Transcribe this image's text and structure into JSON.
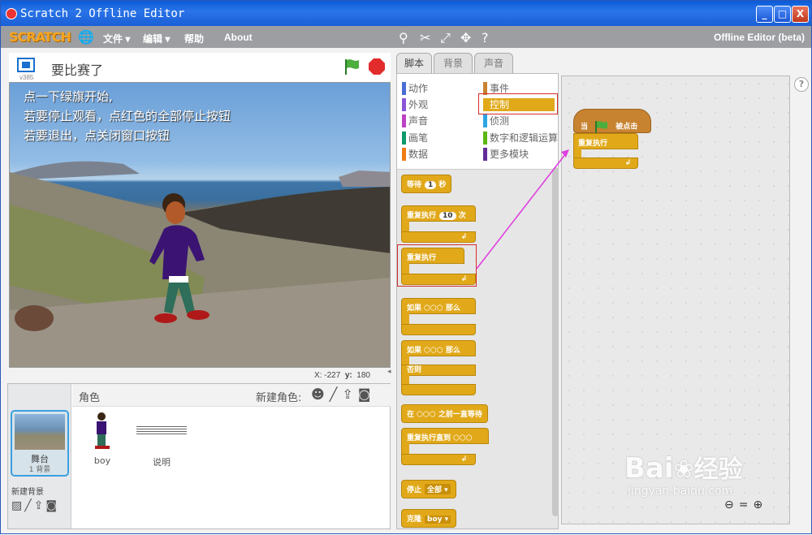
{
  "window": {
    "title": "Scratch 2 Offline Editor",
    "min": "_",
    "max": "□",
    "close": "X"
  },
  "menu": {
    "logo": "SCRATCH",
    "items": [
      "文件",
      "编辑",
      "帮助",
      "About"
    ],
    "file": "文件",
    "edit": "编辑",
    "help": "帮助",
    "about": "About",
    "right_label": "Offline Editor (beta)"
  },
  "stage": {
    "project_title": "要比赛了",
    "version": "v385",
    "lines": [
      "点一下绿旗开始,",
      "若要停止观看，点红色的全部停止按钮",
      "若要退出，点关闭窗口按钮"
    ],
    "x_label": "X:",
    "x_value": "-227",
    "y_label": "y:",
    "y_value": "180"
  },
  "sprites": {
    "header": "角色",
    "new_sprite_label": "新建角色:",
    "stage_name": "舞台",
    "stage_backdrops": "1 背景",
    "new_backdrop_label": "新建背景",
    "items": [
      {
        "name": "boy"
      },
      {
        "name": "说明"
      }
    ]
  },
  "tabs": {
    "scripts": "脚本",
    "backdrops": "背景",
    "sounds": "声音"
  },
  "categories": {
    "motion": "动作",
    "looks": "外观",
    "sound": "声音",
    "pen": "画笔",
    "data": "数据",
    "events": "事件",
    "control": "控制",
    "sensing": "侦测",
    "operators": "数字和逻辑运算",
    "more": "更多模块"
  },
  "blocks": {
    "wait": "等待",
    "wait_val": "1",
    "wait_unit": "秒",
    "repeat": "重复执行",
    "repeat_val": "10",
    "repeat_unit": "次",
    "forever": "重复执行",
    "if": "如果",
    "then": "那么",
    "if2": "如果",
    "then2": "那么",
    "else": "否则",
    "wait_until": "在",
    "wait_until2": "之前一直等待",
    "repeat_until": "重复执行直到",
    "stop": "停止",
    "stop_opt": "全部",
    "when_clone": "克隆",
    "clone_opt": "boy"
  },
  "script": {
    "hat": "当",
    "hat2": "被点击",
    "forever": "重复执行"
  },
  "watermark": {
    "brand": "Bai",
    "brand2": "经验",
    "url": "jingyan.baidu.com"
  },
  "colors": {
    "control": "#e1a91a",
    "events": "#c88330",
    "motion": "#4a6cd4",
    "looks": "#8a55d7",
    "sound": "#bb42c3",
    "pen": "#0e9a6c",
    "data": "#ee7d16",
    "sensing": "#2ca5e2",
    "operators": "#5cb712",
    "more": "#632d99",
    "highlight": "#d62b2b",
    "arrow": "#e040e0"
  }
}
